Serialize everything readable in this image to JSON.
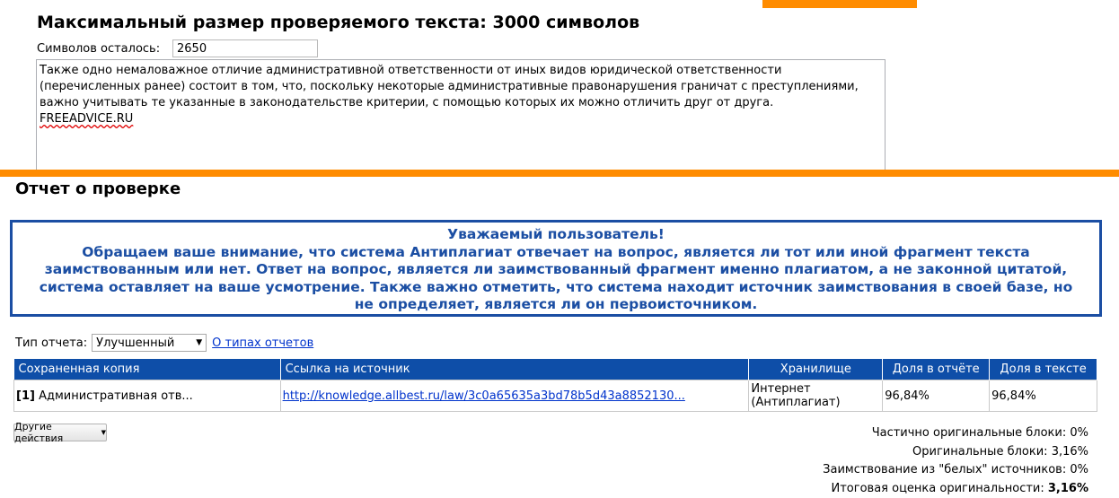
{
  "header": {
    "title": "Максимальный размер проверяемого текста: 3000 символов",
    "chars_left_label": "Символов осталось:",
    "chars_left_value": "2650"
  },
  "input_text": {
    "lines": [
      "Также одно немаловажное отличие административной ответственности от иных видов юридической ответственности",
      "(перечисленных ранее) состоит в том, что, поскольку некоторые административные правонарушения граничат с преступлениями,",
      "важно учитывать те указанные в законодательстве критерии, с помощью которых их можно отличить друг от друга.",
      "FREEADVICE.RU"
    ]
  },
  "report": {
    "title": "Отчет о проверке",
    "notice_lines": [
      "Уважаемый пользователь!",
      "Обращаем ваше внимание, что система Антиплагиат отвечает на вопрос, является ли тот или иной фрагмент текста",
      "заимствованным или нет. Ответ на вопрос, является ли заимствованный фрагмент именно плагиатом, а не законной цитатой,",
      "система оставляет на ваше усмотрение. Также важно отметить, что система находит источник заимствования в своей базе, но",
      "не определяет, является ли он первоисточником."
    ],
    "type_label": "Тип отчета:",
    "type_value": "Улучшенный",
    "type_link": "О типах отчетов"
  },
  "table": {
    "headers": [
      "Сохраненная копия",
      "Ссылка на источник",
      "Хранилище",
      "Доля в отчёте",
      "Доля в тексте"
    ],
    "rows": [
      {
        "index": "[1]",
        "copy": "Административная отв...",
        "link": "http://knowledge.allbest.ru/law/3c0a65635a3bd78b5d43a8852130...",
        "storage_line1": "Интернет",
        "storage_line2": "(Антиплагиат)",
        "share_report": "96,84%",
        "share_text": "96,84%"
      }
    ]
  },
  "actions": {
    "other_label": "Другие действия"
  },
  "stats": {
    "partial_label": "Частично оригинальные блоки:",
    "partial_value": "0%",
    "original_label": "Оригинальные блоки:",
    "original_value": "3,16%",
    "white_label": "Заимствование из \"белых\" источников:",
    "white_value": "0%",
    "total_label": "Итоговая оценка оригинальности:",
    "total_value": "3,16%"
  },
  "colors": {
    "accent_orange": "#ff8c00",
    "header_blue": "#0e4ea8",
    "notice_blue": "#1b4ea3",
    "link_blue": "#0033cc"
  }
}
